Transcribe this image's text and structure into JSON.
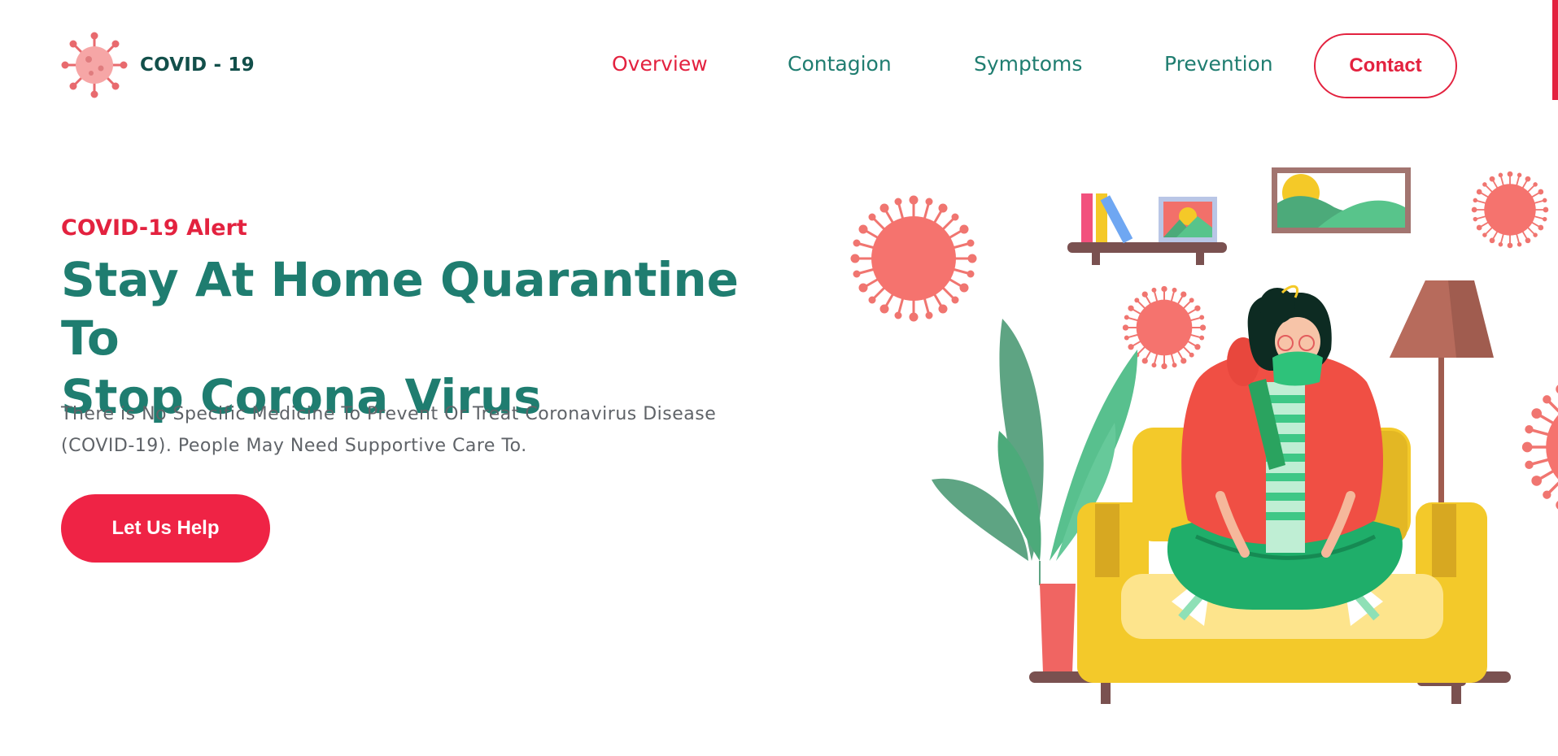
{
  "brand": {
    "name": "COVID - 19",
    "icon": "virus-icon"
  },
  "nav": {
    "items": [
      {
        "label": "Overview",
        "active": true
      },
      {
        "label": "Contagion",
        "active": false
      },
      {
        "label": "Symptoms",
        "active": false
      },
      {
        "label": "Prevention",
        "active": false
      }
    ],
    "contact_label": "Contact"
  },
  "hero": {
    "alert": "COVID-19 Alert",
    "title_line1": "Stay At Home Quarantine To",
    "title_line2": "Stop Corona Virus",
    "desc_line1": "There is No Specific Medicine To Prevent Or Treat Coronavirus Disease",
    "desc_line2": "(COVID-19). People May Need Supportive Care To.",
    "cta_label": "Let Us Help"
  },
  "colors": {
    "accent": "#e3223f",
    "teal": "#1f7d70",
    "dark_teal": "#124f4a",
    "body_text": "#5f6368"
  }
}
